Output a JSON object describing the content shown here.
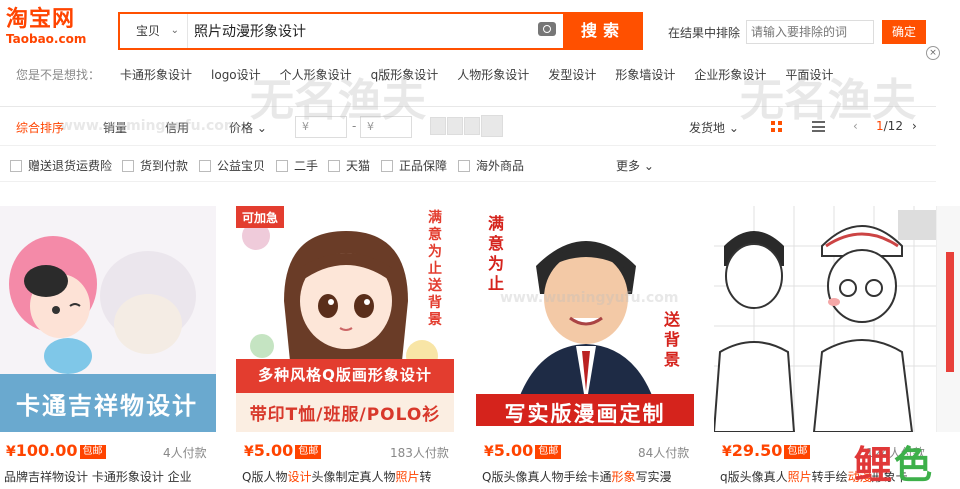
{
  "logo": {
    "cn": "淘宝网",
    "en": "Taobao.com"
  },
  "search": {
    "scope": "宝贝",
    "query": "照片动漫形象设计",
    "button": "搜索"
  },
  "exclude": {
    "label": "在结果中排除",
    "placeholder": "请输入要排除的词",
    "button": "确定"
  },
  "suggest": {
    "label": "您是不是想找：",
    "items": [
      "卡通形象设计",
      "logo设计",
      "个人形象设计",
      "q版形象设计",
      "人物形象设计",
      "发型设计",
      "形象墙设计",
      "企业形象设计",
      "平面设计"
    ]
  },
  "sort": {
    "items": [
      "综合排序",
      "销量",
      "信用",
      "价格"
    ],
    "price_from": "¥",
    "price_to": "¥",
    "dash": "-",
    "location": "发货地",
    "page_current": "1",
    "page_total": "/12"
  },
  "filters": [
    "赠送退货运费险",
    "货到付款",
    "公益宝贝",
    "二手",
    "天猫",
    "正品保障",
    "海外商品"
  ],
  "more": "更多",
  "products": [
    {
      "price": "100.00",
      "currency": "¥",
      "badge": "包邮",
      "paid": "4人付款",
      "title": "品牌吉祥物设计 卡通形象设计 企业",
      "banner": "卡通吉祥物设计"
    },
    {
      "price": "5.00",
      "currency": "¥",
      "badge": "包邮",
      "paid": "183人付款",
      "title_parts": [
        "Q版人物",
        "设计",
        "头像制定真人物",
        "照片",
        "转"
      ],
      "corner": "可加急",
      "side": "满意为止 送背景",
      "banner1": "多种风格Q版画形象设计",
      "banner2": "带印T恤/班服/POLO衫"
    },
    {
      "price": "5.00",
      "currency": "¥",
      "badge": "包邮",
      "paid": "84人付款",
      "title_parts": [
        "Q版头像真人物手绘卡通",
        "形象",
        "写实漫"
      ],
      "side_left": "满意为止",
      "side_right": "送背景",
      "banner": "写实版漫画定制"
    },
    {
      "price": "29.50",
      "currency": "¥",
      "badge": "包邮",
      "paid": "124人付款",
      "title_parts": [
        "q版头像真人",
        "照片",
        "转手绘",
        "动漫",
        "形象卡"
      ]
    }
  ],
  "watermark": {
    "cn": "无名渔夫",
    "url": "www.wumingyufu.com"
  },
  "corner_logo": {
    "a": "鲤",
    "b": "色"
  },
  "colors": {
    "accent": "#ff5000",
    "price": "#ff4400"
  }
}
